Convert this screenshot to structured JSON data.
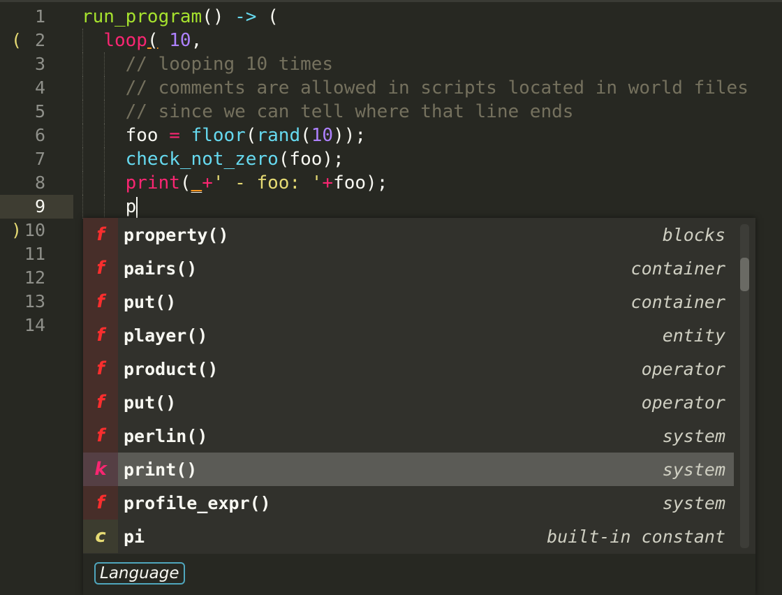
{
  "gutter": {
    "lines": [
      "1",
      "2",
      "3",
      "4",
      "5",
      "6",
      "7",
      "8",
      "9",
      "10",
      "11",
      "12",
      "13",
      "14"
    ],
    "current_line": "9",
    "markers": {
      "2": "(",
      "10": ")"
    }
  },
  "code": [
    [
      [
        "run_program",
        "g"
      ],
      [
        "() ",
        "w"
      ],
      [
        "->",
        "c"
      ],
      [
        " (",
        "w"
      ]
    ],
    [
      [
        "  ",
        "w"
      ],
      [
        "loop",
        "p"
      ],
      [
        "(",
        "u"
      ],
      [
        " ",
        "w"
      ],
      [
        "10",
        "v"
      ],
      [
        ",",
        "w"
      ]
    ],
    [
      [
        "    ",
        "w"
      ],
      [
        "// looping 10 times",
        "m"
      ]
    ],
    [
      [
        "    ",
        "w"
      ],
      [
        "// comments are allowed in scripts located in world files",
        "m"
      ]
    ],
    [
      [
        "    ",
        "w"
      ],
      [
        "// since we can tell where that line ends",
        "m"
      ]
    ],
    [
      [
        "    foo ",
        "w"
      ],
      [
        "=",
        "p"
      ],
      [
        " ",
        "w"
      ],
      [
        "floor",
        "c"
      ],
      [
        "(",
        "w"
      ],
      [
        "rand",
        "c"
      ],
      [
        "(",
        "w"
      ],
      [
        "10",
        "v"
      ],
      [
        "));",
        "w"
      ]
    ],
    [
      [
        "    ",
        "w"
      ],
      [
        "check_not_zero",
        "c"
      ],
      [
        "(foo);",
        "w"
      ]
    ],
    [
      [
        "    ",
        "w"
      ],
      [
        "print",
        "p"
      ],
      [
        "(",
        "w"
      ],
      [
        "_",
        "u"
      ],
      [
        "+",
        "p"
      ],
      [
        "' - foo: '",
        "y"
      ],
      [
        "+",
        "p"
      ],
      [
        "foo);",
        "w"
      ]
    ],
    [
      [
        "    p",
        "w"
      ]
    ]
  ],
  "autocomplete": {
    "items": [
      {
        "kind": "f",
        "name": "property()",
        "type": "blocks"
      },
      {
        "kind": "f",
        "name": "pairs()",
        "type": "container"
      },
      {
        "kind": "f",
        "name": "put()",
        "type": "container"
      },
      {
        "kind": "f",
        "name": "player()",
        "type": "entity"
      },
      {
        "kind": "f",
        "name": "product()",
        "type": "operator"
      },
      {
        "kind": "f",
        "name": "put()",
        "type": "operator"
      },
      {
        "kind": "f",
        "name": "perlin()",
        "type": "system"
      },
      {
        "kind": "k",
        "name": "print()",
        "type": "system",
        "selected": true
      },
      {
        "kind": "f",
        "name": "profile_expr()",
        "type": "system"
      },
      {
        "kind": "c",
        "name": "pi",
        "type": "built-in constant"
      }
    ],
    "footer_label": "Language"
  }
}
